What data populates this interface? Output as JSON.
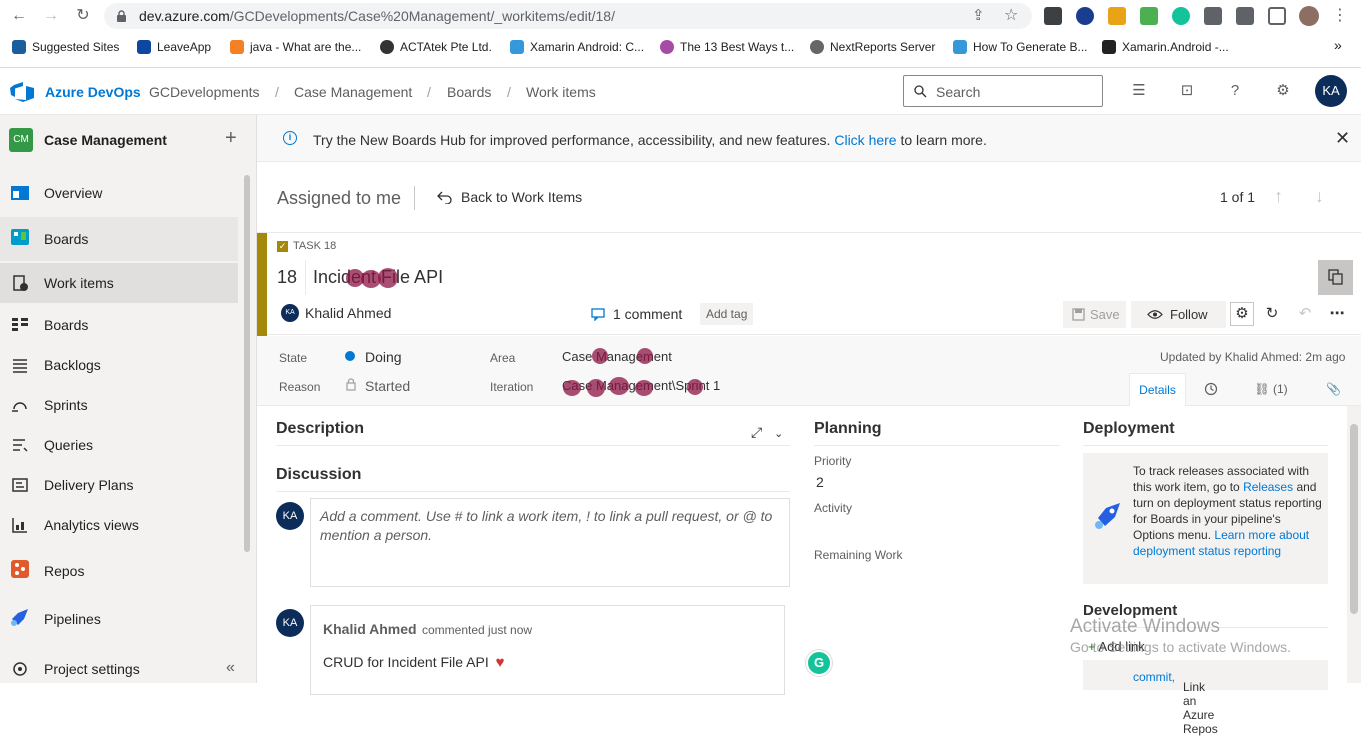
{
  "browser": {
    "url_host": "dev.azure.com",
    "url_path": "/GCDevelopments/Case%20Management/_workitems/edit/18/",
    "bookmarks": [
      "Suggested Sites",
      "LeaveApp",
      "java - What are the...",
      "ACTAtek Pte Ltd.",
      "Xamarin Android: C...",
      "The 13 Best Ways t...",
      "NextReports Server",
      "How To Generate B...",
      "Xamarin.Android -..."
    ],
    "more": "»"
  },
  "header": {
    "product": "Azure DevOps",
    "breadcrumbs": [
      "GCDevelopments",
      "Case Management",
      "Boards",
      "Work items"
    ],
    "separator": "/",
    "search_placeholder": "Search",
    "avatar": "KA"
  },
  "sidebar": {
    "project_badge": "CM",
    "project_name": "Case Management",
    "add": "+",
    "items": [
      {
        "label": "Overview",
        "icon": "overview-icon"
      },
      {
        "label": "Boards",
        "icon": "boards-hub-icon"
      },
      {
        "label": "Work items",
        "icon": "work-items-icon"
      },
      {
        "label": "Boards",
        "icon": "boards-icon"
      },
      {
        "label": "Backlogs",
        "icon": "backlogs-icon"
      },
      {
        "label": "Sprints",
        "icon": "sprints-icon"
      },
      {
        "label": "Queries",
        "icon": "queries-icon"
      },
      {
        "label": "Delivery Plans",
        "icon": "delivery-plans-icon"
      },
      {
        "label": "Analytics views",
        "icon": "analytics-icon"
      },
      {
        "label": "Repos",
        "icon": "repos-icon"
      },
      {
        "label": "Pipelines",
        "icon": "pipelines-icon"
      },
      {
        "label": "Project settings",
        "icon": "settings-icon"
      }
    ],
    "collapse": "«"
  },
  "banner": {
    "text_before": "Try the New Boards Hub for improved performance, accessibility, and new features.",
    "link": "Click here",
    "text_after": "to learn more."
  },
  "toolbar": {
    "assigned": "Assigned to me",
    "back": "Back to Work Items",
    "pager": "1 of 1"
  },
  "work_item": {
    "type_label": "TASK 18",
    "id": "18",
    "title": "Incident File API",
    "assignee": "Khalid Ahmed",
    "assignee_initials": "KA",
    "comments": "1 comment",
    "add_tag": "Add tag",
    "save": "Save",
    "follow": "Follow",
    "color": "#a4880a"
  },
  "fields": {
    "state_label": "State",
    "state_value": "Doing",
    "reason_label": "Reason",
    "reason_value": "Started",
    "area_label": "Area",
    "area_value": "Case Management",
    "iteration_label": "Iteration",
    "iteration_value": "Case Management\\Sprint 1",
    "updated": "Updated by Khalid Ahmed: 2m ago",
    "tabs": {
      "details": "Details",
      "links": "(1)"
    }
  },
  "body": {
    "description": "Description",
    "discussion": "Discussion",
    "comment_placeholder": "Add a comment. Use # to link a work item, ! to link a pull request, or @ to mention a person.",
    "commenter_initials": "KA",
    "comment_author": "Khalid Ahmed",
    "comment_meta": "commented just now",
    "comment_text": "CRUD for Incident File API",
    "planning": "Planning",
    "priority_label": "Priority",
    "priority_value": "2",
    "activity_label": "Activity",
    "remaining_label": "Remaining Work",
    "deployment": "Deployment",
    "deploy_t1": "To track releases associated with this work item, go to",
    "deploy_link1": "Releases",
    "deploy_t2": "and turn on deployment status reporting for Boards in your pipeline's Options menu.",
    "deploy_link2": "Learn more about deployment status reporting",
    "development": "Development",
    "add_link": "Add link",
    "dev_text": "Link an Azure Repos",
    "dev_link": "commit,"
  },
  "watermark": {
    "line1": "Activate Windows",
    "line2": "Go to Settings to activate Windows."
  }
}
